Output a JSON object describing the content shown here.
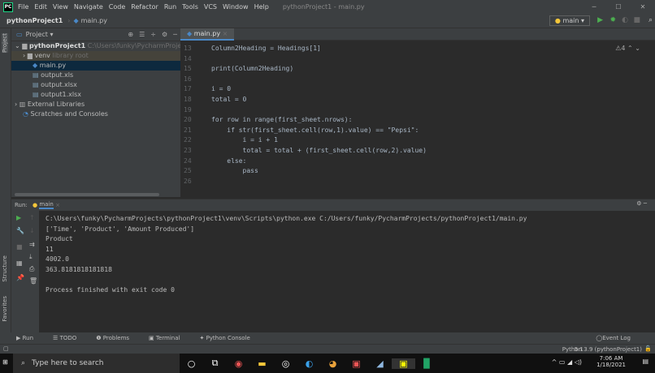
{
  "titlebar": {
    "menu": [
      "File",
      "Edit",
      "View",
      "Navigate",
      "Code",
      "Refactor",
      "Run",
      "Tools",
      "VCS",
      "Window",
      "Help"
    ],
    "title": "pythonProject1 - main.py"
  },
  "navbar": {
    "project": "pythonProject1",
    "file": "main.py",
    "run_config": "main"
  },
  "project_panel": {
    "title": "Project",
    "root": "pythonProject1",
    "root_path": "C:\\Users\\funky\\PycharmProjects\\pythonProject1",
    "venv": "venv",
    "venv_note": "library root",
    "files": [
      "main.py",
      "output.xls",
      "output.xlsx",
      "output1.xlsx"
    ],
    "external": "External Libraries",
    "scratches": "Scratches and Consoles"
  },
  "editor": {
    "tab": "main.py",
    "warnings": "4",
    "lines": [
      {
        "n": "13",
        "code": "Column2Heading = Headings[1]"
      },
      {
        "n": "14",
        "code": ""
      },
      {
        "n": "15",
        "code": "print(Column2Heading)"
      },
      {
        "n": "16",
        "code": ""
      },
      {
        "n": "17",
        "code": "i = 0"
      },
      {
        "n": "18",
        "code": "total = 0"
      },
      {
        "n": "19",
        "code": ""
      },
      {
        "n": "20",
        "code": "for row in range(first_sheet.nrows):"
      },
      {
        "n": "21",
        "code": "    if str(first_sheet.cell(row,1).value) == \"Pepsi\":"
      },
      {
        "n": "22",
        "code": "        i = i + 1"
      },
      {
        "n": "23",
        "code": "        total = total + (first_sheet.cell(row,2).value)"
      },
      {
        "n": "24",
        "code": "    else:"
      },
      {
        "n": "25",
        "code": "        pass"
      },
      {
        "n": "26",
        "code": ""
      }
    ]
  },
  "run": {
    "label": "Run:",
    "tab": "main",
    "output": [
      "C:\\Users\\funky\\PycharmProjects\\pythonProject1\\venv\\Scripts\\python.exe C:/Users/funky/PycharmProjects/pythonProject1/main.py",
      "['Time', 'Product', 'Amount Produced']",
      "Product",
      "11",
      "4002.0",
      "363.8181818181818",
      "",
      "Process finished with exit code 0"
    ]
  },
  "side": {
    "project": "Project",
    "structure": "Structure",
    "favorites": "Favorites"
  },
  "bottombar": {
    "run": "Run",
    "todo": "TODO",
    "problems": "Problems",
    "terminal": "Terminal",
    "console": "Python Console",
    "event_log": "Event Log"
  },
  "status": {
    "pos": "5:1",
    "interpreter": "Python 3.9 (pythonProject1)"
  },
  "taskbar": {
    "search": "Type here to search",
    "time": "7:06 AM",
    "date": "1/18/2021"
  }
}
